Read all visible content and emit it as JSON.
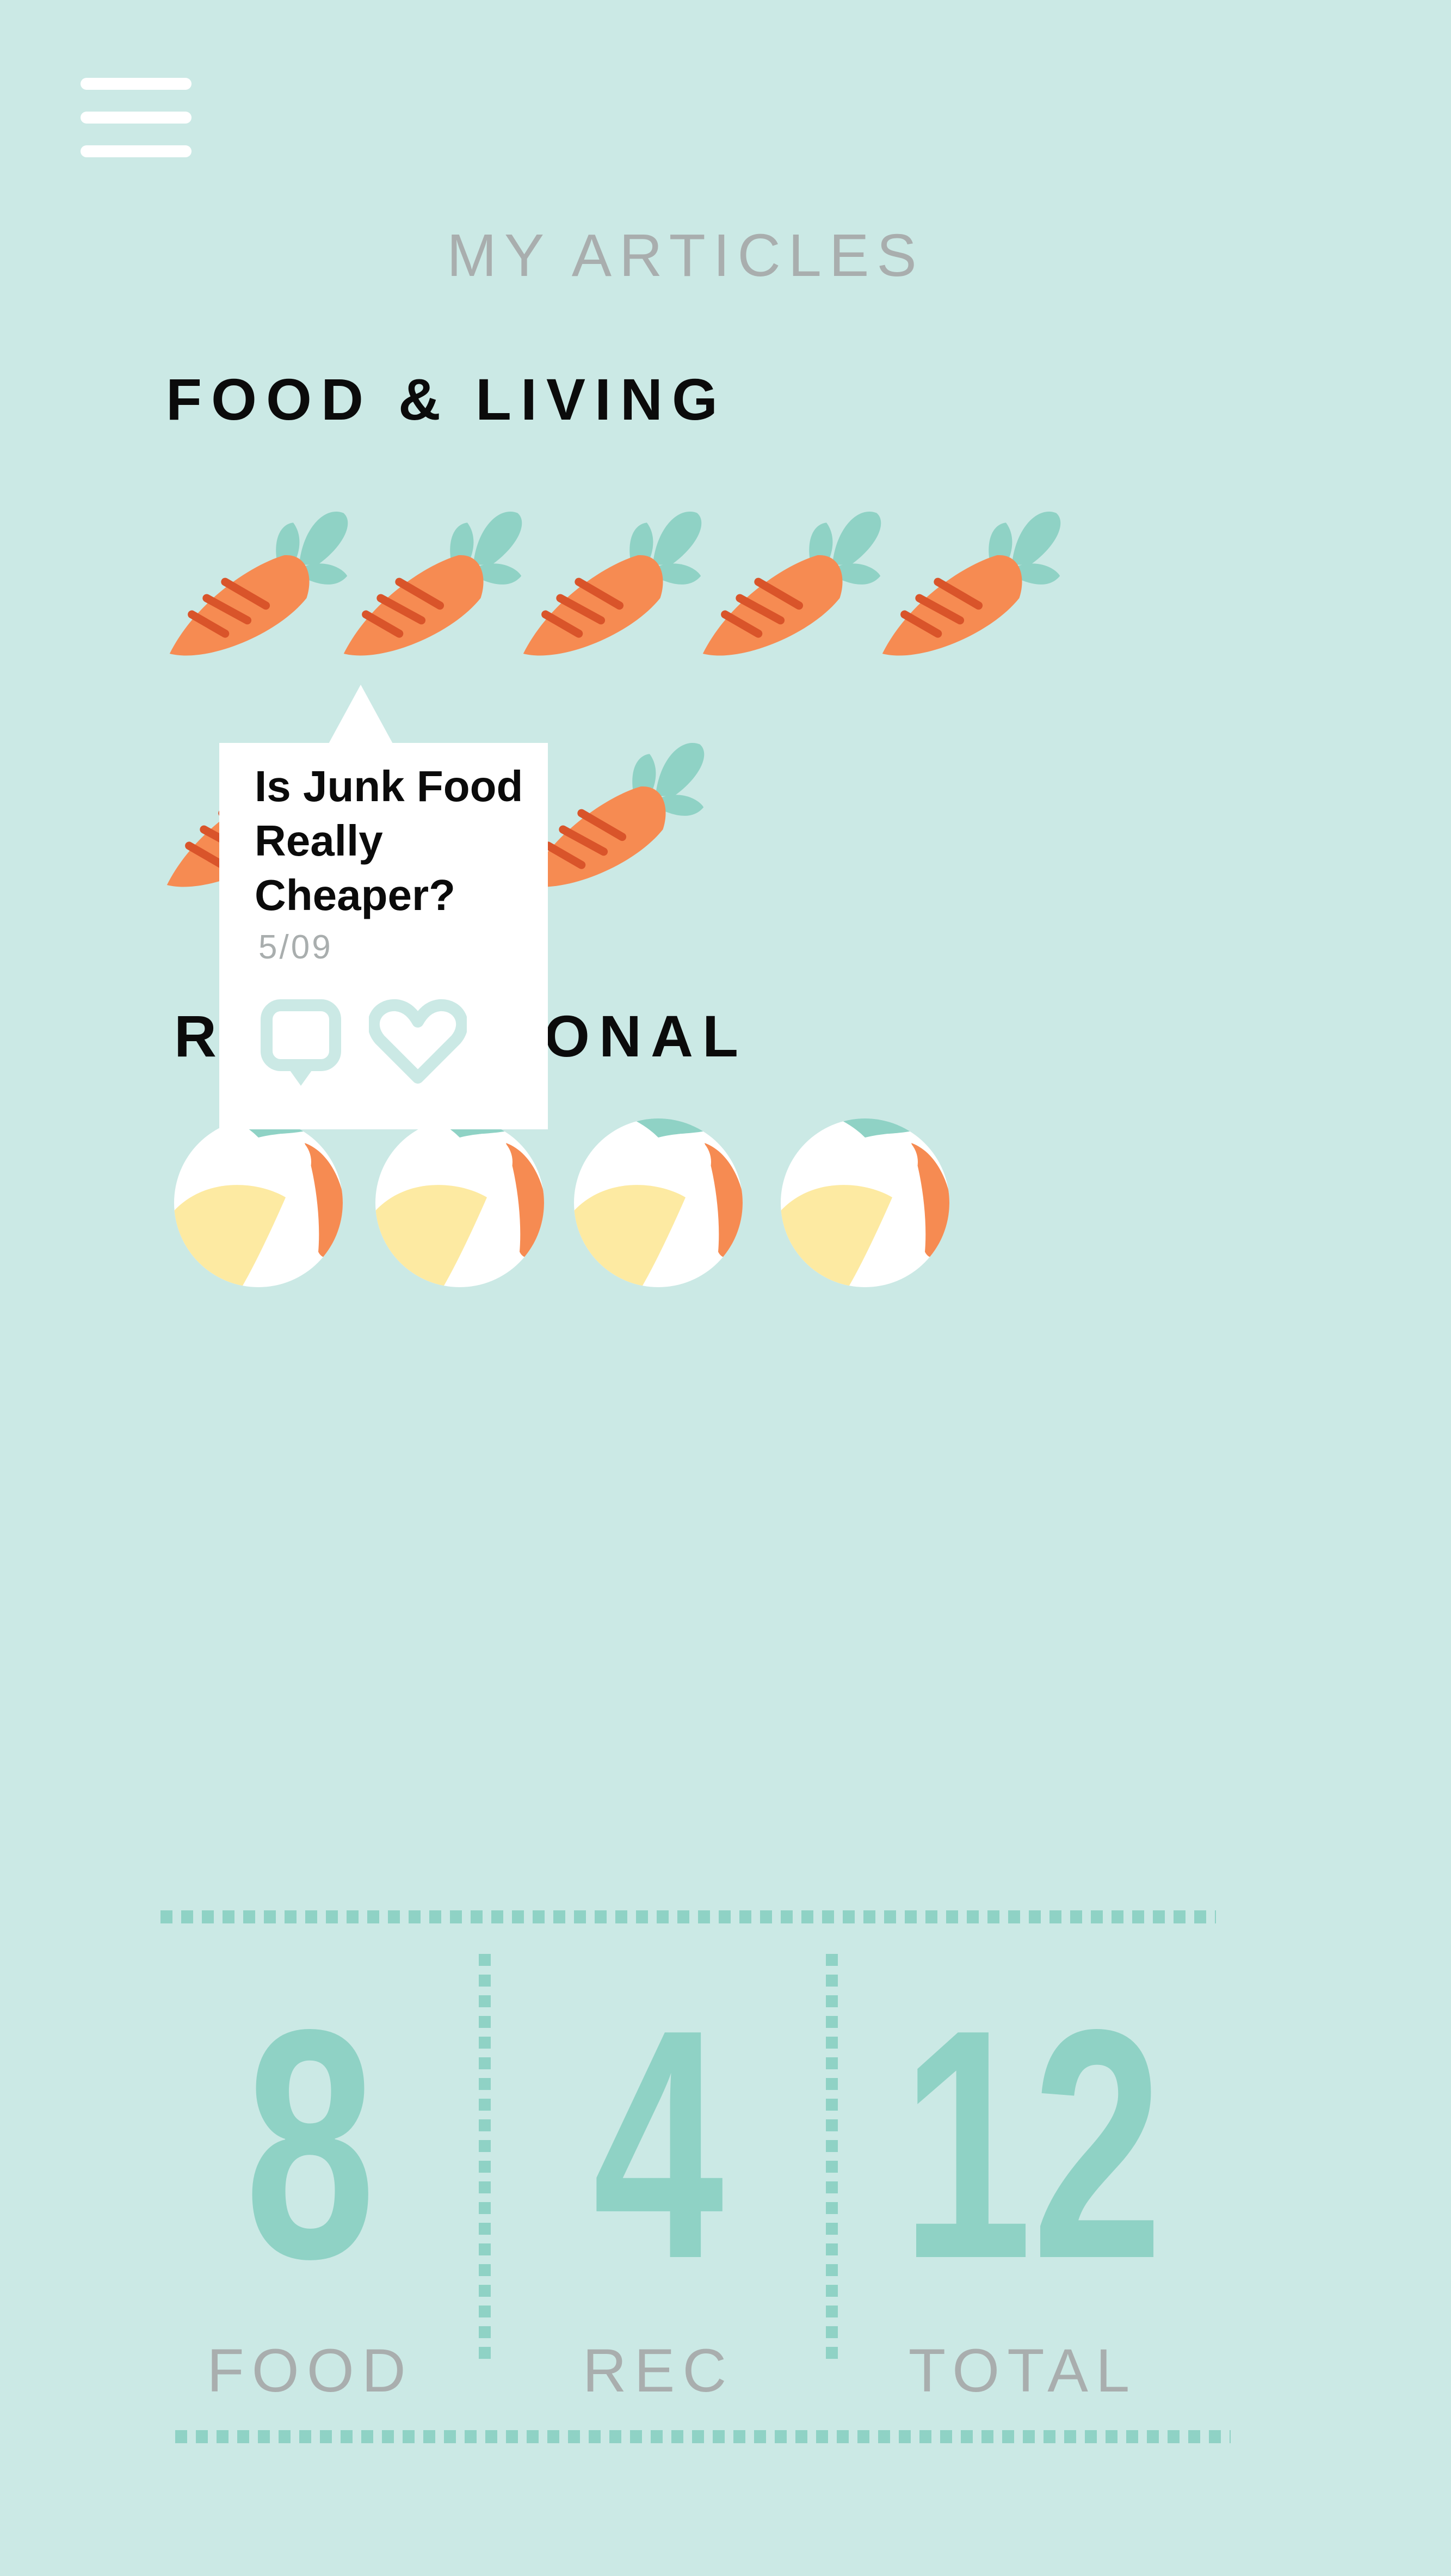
{
  "header": {
    "title": "MY ARTICLES",
    "menu_icon": "hamburger-menu-icon"
  },
  "sections": [
    {
      "title": "FOOD & LIVING",
      "icon": "carrot-icon",
      "article_count": 8
    },
    {
      "title": "RECREATIONAL",
      "icon": "beach-ball-icon",
      "article_count": 4
    }
  ],
  "tooltip": {
    "title": "Is Junk Food Really Cheaper?",
    "date": "5/09",
    "actions": [
      "comment-icon",
      "heart-icon"
    ]
  },
  "stats": {
    "food": {
      "value": "8",
      "label": "FOOD"
    },
    "rec": {
      "value": "4",
      "label": "REC"
    },
    "total": {
      "value": "12",
      "label": "TOTAL"
    }
  },
  "colors": {
    "background": "#cbe9e5",
    "accent": "#8fd2c5",
    "carrot": "#f68b52",
    "carrot_stripe": "#d9542a",
    "ball_yellow": "#fdeaa2",
    "muted_text": "#a9aeae"
  }
}
